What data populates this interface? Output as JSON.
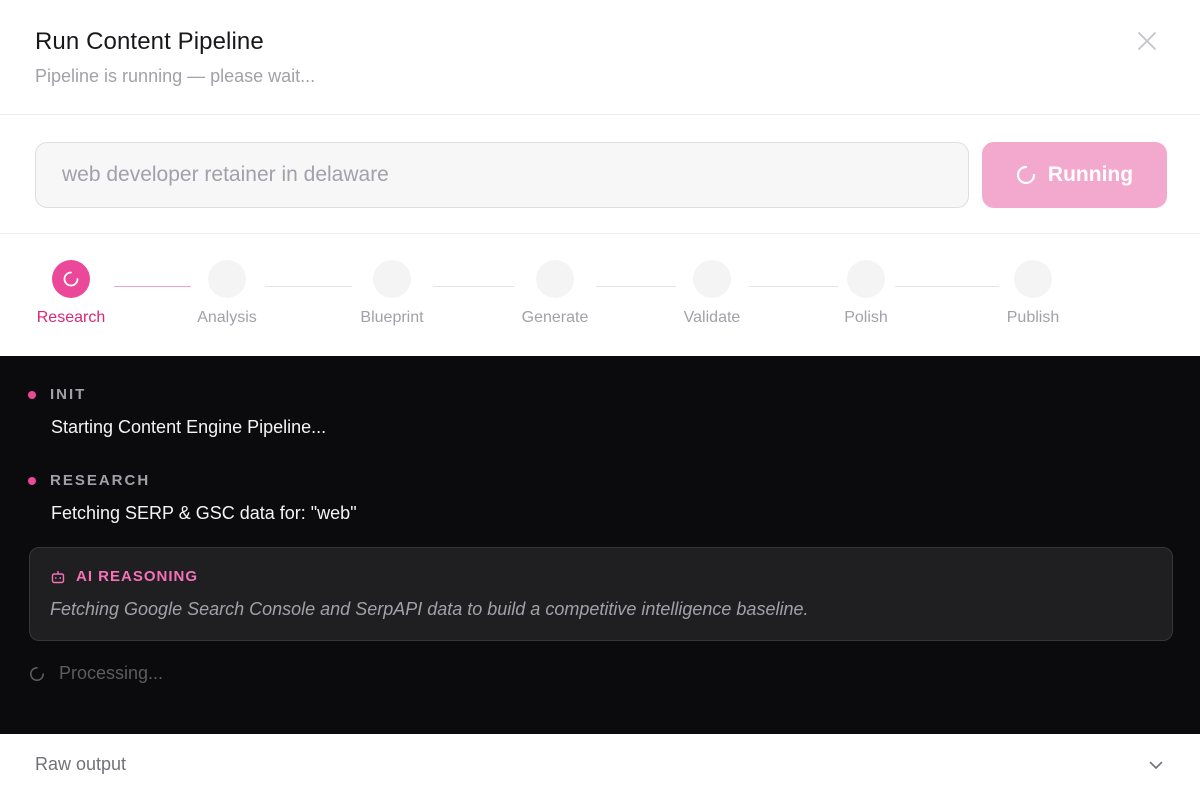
{
  "header": {
    "title": "Run Content Pipeline",
    "subtitle": "Pipeline is running — please wait..."
  },
  "query": {
    "placeholder": "web developer retainer in delaware",
    "value": ""
  },
  "run_button": {
    "label": "Running",
    "icon": "spinner-icon"
  },
  "steps": [
    {
      "label": "Research",
      "state": "active"
    },
    {
      "label": "Analysis",
      "state": "pending"
    },
    {
      "label": "Blueprint",
      "state": "pending"
    },
    {
      "label": "Generate",
      "state": "pending"
    },
    {
      "label": "Validate",
      "state": "pending"
    },
    {
      "label": "Polish",
      "state": "pending"
    },
    {
      "label": "Publish",
      "state": "pending"
    }
  ],
  "log": {
    "entries": [
      {
        "tag": "INIT",
        "message": "Starting Content Engine Pipeline..."
      },
      {
        "tag": "RESEARCH",
        "message": "Fetching SERP & GSC data for: \"web\""
      }
    ],
    "reasoning": {
      "title": "AI REASONING",
      "icon": "robot-icon",
      "text": "Fetching Google Search Console and SerpAPI data to build a competitive intelligence baseline."
    },
    "processing": "Processing..."
  },
  "footer": {
    "label": "Raw output",
    "icon": "chevron-down-icon"
  },
  "colors": {
    "accent": "#ec4899",
    "accent_light": "#f3a8ce",
    "log_bg": "#0b0b0d"
  }
}
